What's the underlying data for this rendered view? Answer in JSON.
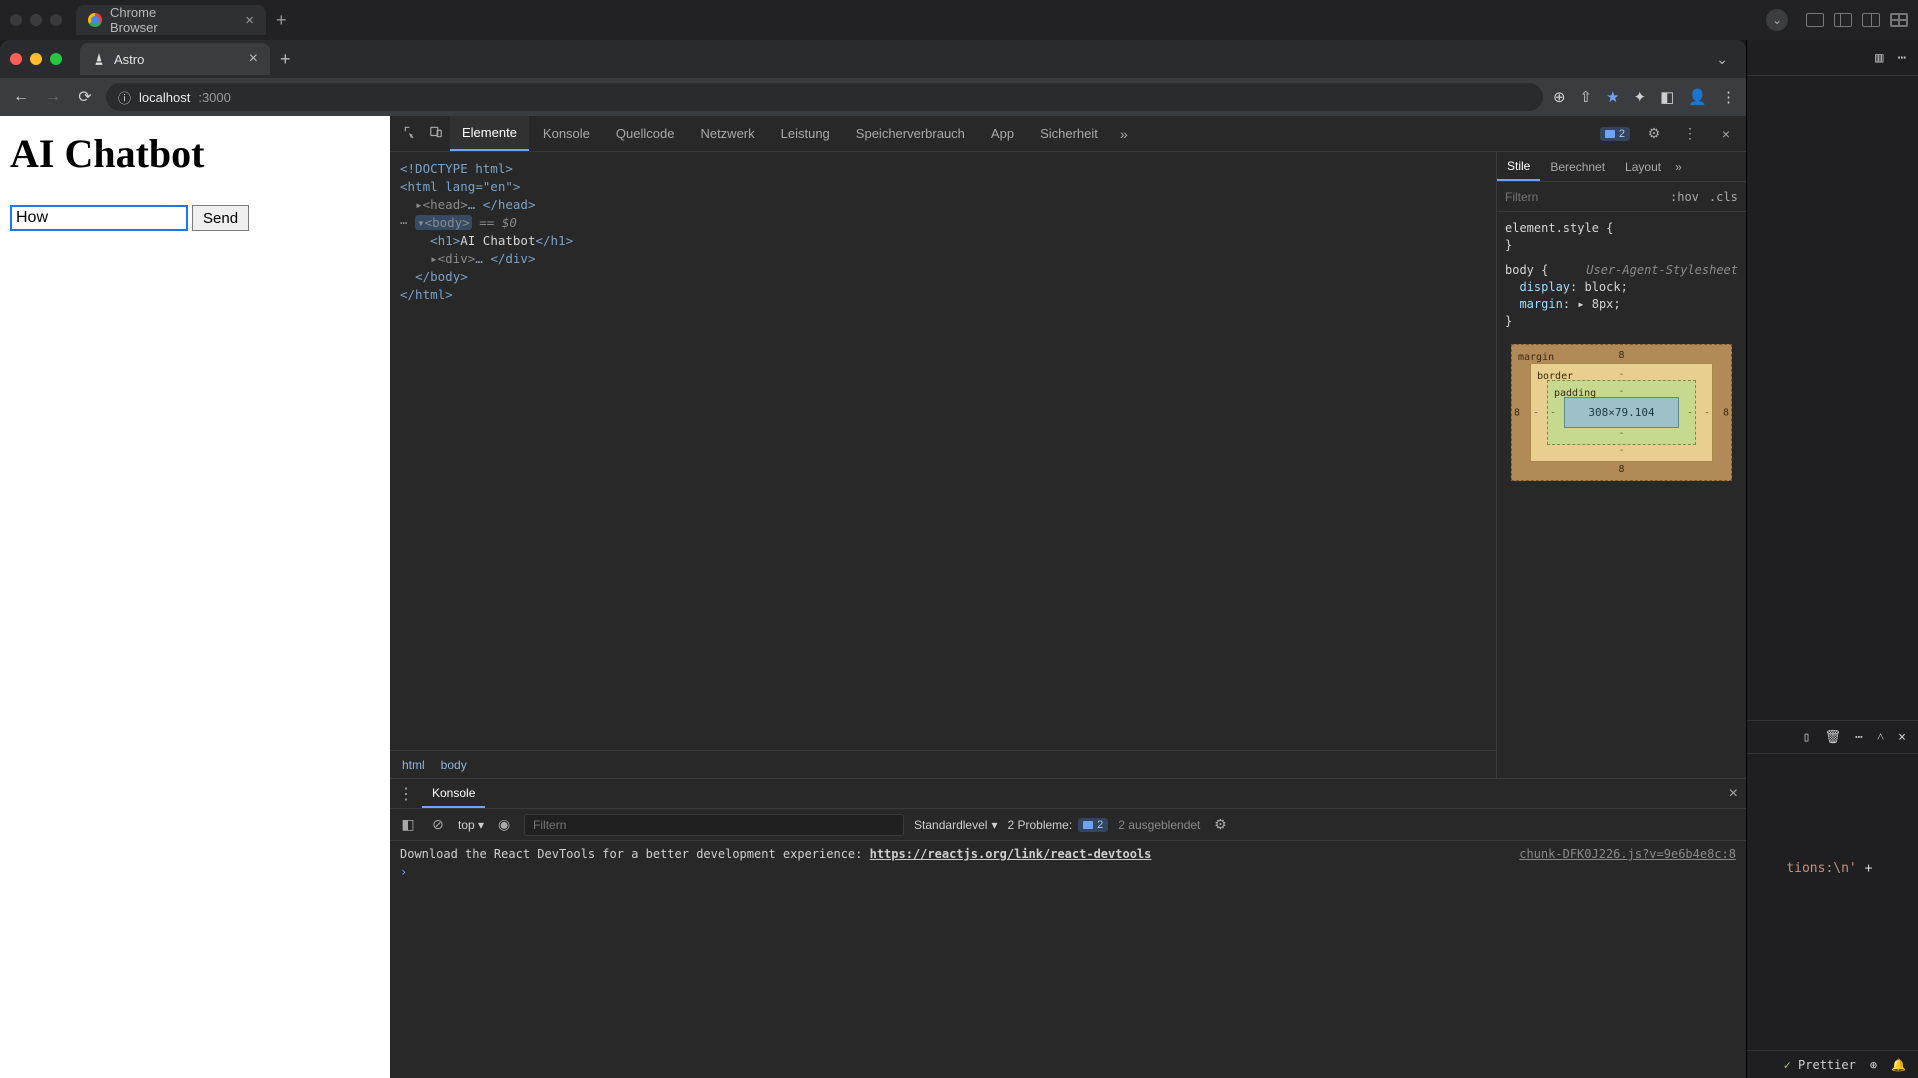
{
  "host": {
    "tab_title": "Chrome Browser"
  },
  "browser": {
    "tab_title": "Astro",
    "url_host": "localhost",
    "url_path": ":3000"
  },
  "page": {
    "heading": "AI Chatbot",
    "input_value": "How ",
    "send_label": "Send"
  },
  "devtools": {
    "tabs": {
      "elements": "Elemente",
      "console": "Konsole",
      "sources": "Quellcode",
      "network": "Netzwerk",
      "performance": "Leistung",
      "memory": "Speicherverbrauch",
      "application": "App",
      "security": "Sicherheit"
    },
    "issue_badge": "2",
    "dom": {
      "l0": "<!DOCTYPE html>",
      "l1": "<html lang=\"en\">",
      "l2": "▸<head>",
      "l2b": "… </head>",
      "l3": "▾<body>",
      "l3s": " == $0",
      "l4": "<h1>",
      "l4t": "AI Chatbot",
      "l4c": "</h1>",
      "l5": "▸<div>",
      "l5b": "… </div>",
      "l6": "</body>",
      "l7": "</html>"
    },
    "crumbs": {
      "a": "html",
      "b": "body"
    },
    "styles": {
      "tabs": {
        "styles": "Stile",
        "computed": "Berechnet",
        "layout": "Layout"
      },
      "filter_placeholder": "Filtern",
      "hov": ":hov",
      "cls": ".cls",
      "element_style": "element.style {",
      "brace_close": "}",
      "body_sel": "body {",
      "ua_sheet": "User-Agent-Stylesheet",
      "display_prop": "display",
      "display_val": "block",
      "margin_prop": "margin",
      "margin_val": "▸ 8px",
      "box": {
        "margin_label": "margin",
        "border_label": "border",
        "padding_label": "padding",
        "content": "308×79.104",
        "m": "8",
        "dash": "-"
      }
    },
    "drawer": {
      "tab": "Konsole",
      "context": "top",
      "filter_placeholder": "Filtern",
      "level": "Standardlevel",
      "issues_label": "2 Probleme:",
      "issues_count": "2",
      "hidden": "2 ausgeblendet",
      "log_src": "chunk-DFK0J226.js?v=9e6b4e8c:8",
      "log_msg": "Download the React DevTools for a better development experience: ",
      "log_link": "https://reactjs.org/link/react-devtools",
      "prompt": "›"
    }
  },
  "editor": {
    "code_peek": "tions:\\n' +",
    "prettier": "Prettier"
  }
}
